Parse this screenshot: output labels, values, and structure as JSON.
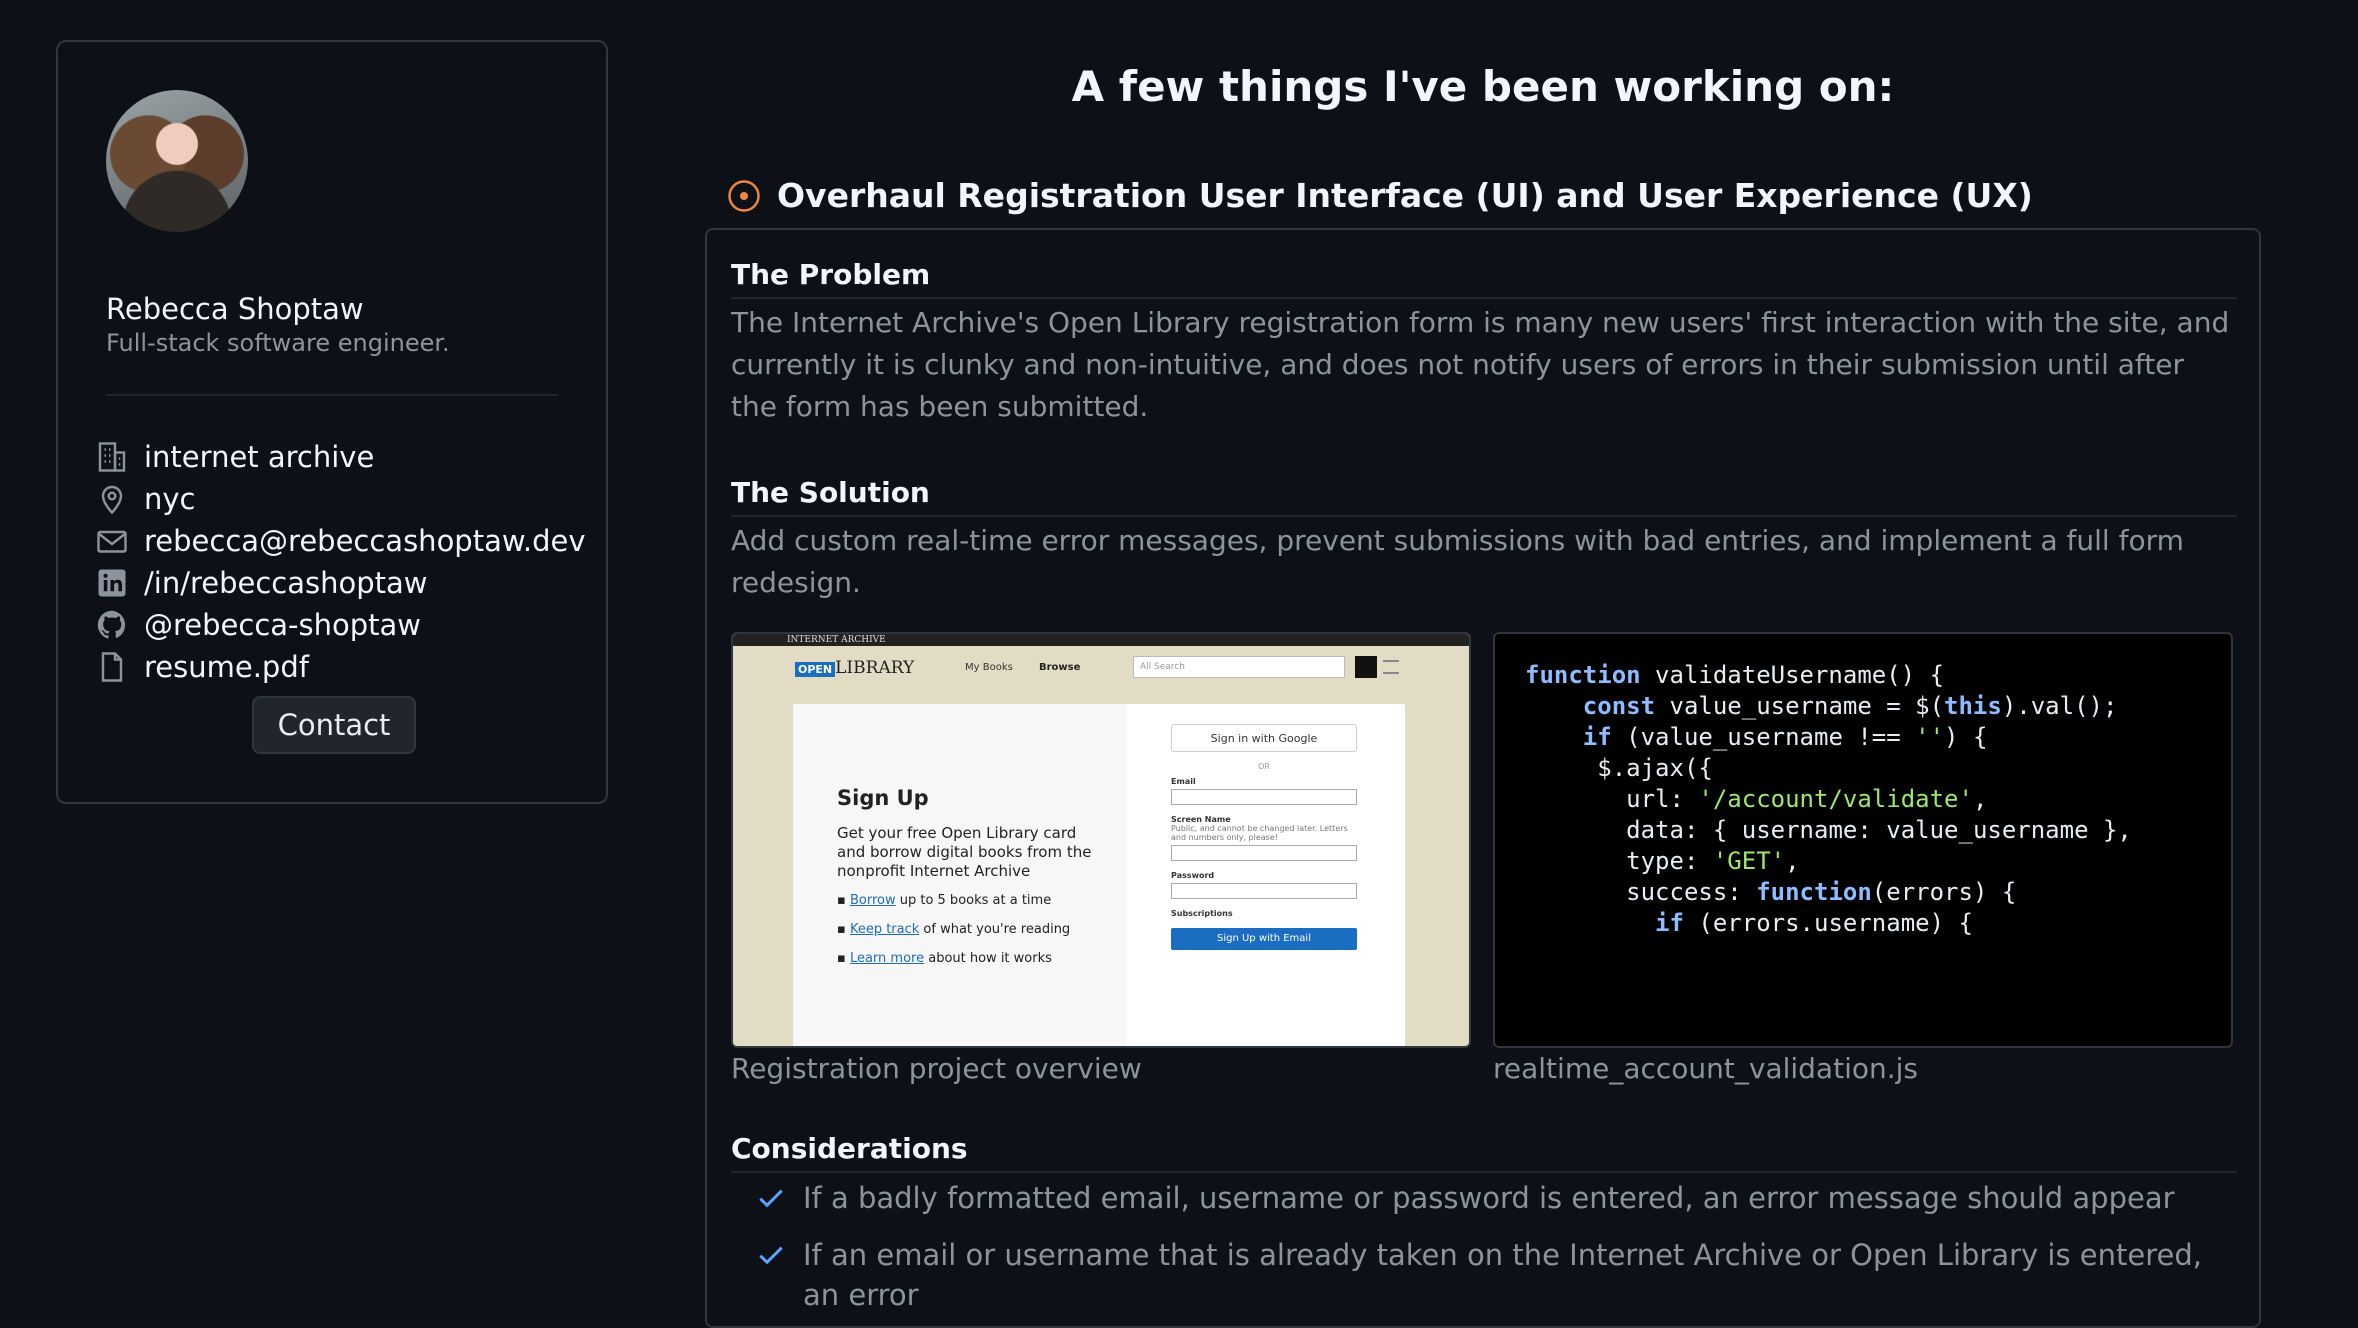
{
  "profile": {
    "name": "Rebecca Shoptaw",
    "tagline": "Full-stack software engineer.",
    "info": [
      {
        "icon": "building-icon",
        "text": "internet archive"
      },
      {
        "icon": "location-pin-icon",
        "text": "nyc"
      },
      {
        "icon": "mail-icon",
        "text": "rebecca@rebeccashoptaw.dev"
      },
      {
        "icon": "linkedin-icon",
        "text": "/in/rebeccashoptaw"
      },
      {
        "icon": "github-icon",
        "text": "@rebecca-shoptaw"
      },
      {
        "icon": "file-icon",
        "text": "resume.pdf"
      }
    ],
    "contact_label": "Contact"
  },
  "main": {
    "heading": "A few things I've been working on:",
    "project": {
      "title": "Overhaul Registration User Interface (UI) and User Experience (UX)",
      "problem_heading": "The Problem",
      "problem_text": "The Internet Archive's Open Library registration form is many new users' first interaction with the site, and currently it is clunky and non-intuitive, and does not notify users of errors in their submission until after the form has been submitted.",
      "solution_heading": "The Solution",
      "solution_text": "Add custom real-time error messages, prevent submissions with bad entries, and implement a full form redesign.",
      "image_caption": "Registration project overview",
      "code_caption": "realtime_account_validation.js",
      "considerations_heading": "Considerations",
      "considerations": [
        "If a badly formatted email, username or password is entered, an error message should appear",
        "If an email or username that is already taken on the Internet Archive or Open Library is entered, an error"
      ]
    }
  },
  "screenshot": {
    "topbar": "INTERNET ARCHIVE",
    "logo_open": "OPEN",
    "logo_library": "LIBRARY",
    "nav_mybooks": "My Books",
    "nav_browse": "Browse",
    "search_placeholder": "All   Search",
    "signup_title": "Sign Up",
    "signup_text": "Get your free Open Library card and borrow digital books from the nonprofit Internet Archive",
    "item1_link": "Borrow",
    "item1_text": " up to 5 books at a time",
    "item2_link": "Keep track",
    "item2_text": " of what you're reading",
    "item3_link": "Learn more",
    "item3_text": " about how it works",
    "google_btn": "Sign in with Google",
    "or": "OR",
    "email_label": "Email",
    "screen_name_label": "Screen Name",
    "screen_name_hint": "Public, and cannot be changed later. Letters and numbers only, please!",
    "password_label": "Password",
    "subscriptions_label": "Subscriptions",
    "signup_button": "Sign Up with Email"
  },
  "code": [
    {
      "kw": "function",
      "rest": " validateUsername() {",
      "indent": ""
    },
    {
      "kw": "const",
      "rest": " value_username = $(this).val();",
      "indent": "    "
    },
    {
      "kw": "if",
      "rest": " (value_username !== '') {",
      "indent": "    "
    },
    {
      "kw": "",
      "rest": "$.ajax({",
      "indent": "     "
    },
    {
      "kw": "",
      "rest": "url: '/account/validate',",
      "indent": "       "
    },
    {
      "kw": "",
      "rest": "data: { username: value_username },",
      "indent": "       "
    },
    {
      "kw": "",
      "rest": "type: 'GET',",
      "indent": "       "
    },
    {
      "kw": "",
      "rest": "success: function(errors) {",
      "indent": "       "
    },
    {
      "kw": "if",
      "rest": " (errors.username) {",
      "indent": "         "
    }
  ]
}
